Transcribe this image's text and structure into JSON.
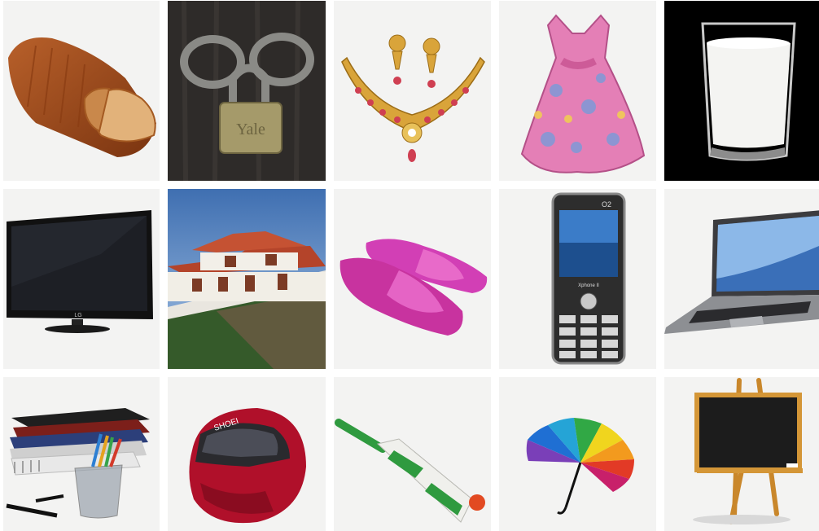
{
  "tiles": [
    {
      "icon": "bread-icon"
    },
    {
      "icon": "padlock-icon"
    },
    {
      "icon": "necklace-icon"
    },
    {
      "icon": "dress-icon"
    },
    {
      "icon": "milk-glass-icon"
    },
    {
      "icon": "television-icon"
    },
    {
      "icon": "house-icon"
    },
    {
      "icon": "slippers-icon"
    },
    {
      "icon": "mobile-phone-icon"
    },
    {
      "icon": "laptop-icon"
    },
    {
      "icon": "books-stationery-icon"
    },
    {
      "icon": "helmet-icon"
    },
    {
      "icon": "cricket-bat-icon"
    },
    {
      "icon": "umbrella-icon"
    },
    {
      "icon": "blackboard-easel-icon"
    }
  ],
  "labels": {
    "padlock_brand": "Yale",
    "phone_brand": "O2",
    "phone_model": "Xphone II",
    "tv_brand": "LG",
    "helmet_brand": "SHOEI"
  },
  "colors": {
    "tile_bg": "#f3f3f2",
    "dress_pink": "#e47fb6",
    "slipper_magenta": "#d23fb5",
    "helmet_red": "#b0102a",
    "bat_green": "#2f9a3f",
    "board_black": "#1c1c1c"
  }
}
